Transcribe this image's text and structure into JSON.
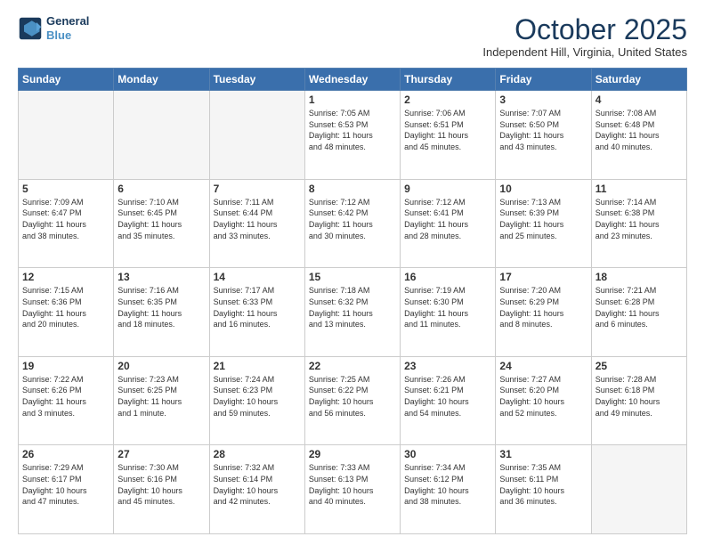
{
  "header": {
    "logo_line1": "General",
    "logo_line2": "Blue",
    "month": "October 2025",
    "location": "Independent Hill, Virginia, United States"
  },
  "weekdays": [
    "Sunday",
    "Monday",
    "Tuesday",
    "Wednesday",
    "Thursday",
    "Friday",
    "Saturday"
  ],
  "weeks": [
    [
      {
        "day": "",
        "info": ""
      },
      {
        "day": "",
        "info": ""
      },
      {
        "day": "",
        "info": ""
      },
      {
        "day": "1",
        "info": "Sunrise: 7:05 AM\nSunset: 6:53 PM\nDaylight: 11 hours\nand 48 minutes."
      },
      {
        "day": "2",
        "info": "Sunrise: 7:06 AM\nSunset: 6:51 PM\nDaylight: 11 hours\nand 45 minutes."
      },
      {
        "day": "3",
        "info": "Sunrise: 7:07 AM\nSunset: 6:50 PM\nDaylight: 11 hours\nand 43 minutes."
      },
      {
        "day": "4",
        "info": "Sunrise: 7:08 AM\nSunset: 6:48 PM\nDaylight: 11 hours\nand 40 minutes."
      }
    ],
    [
      {
        "day": "5",
        "info": "Sunrise: 7:09 AM\nSunset: 6:47 PM\nDaylight: 11 hours\nand 38 minutes."
      },
      {
        "day": "6",
        "info": "Sunrise: 7:10 AM\nSunset: 6:45 PM\nDaylight: 11 hours\nand 35 minutes."
      },
      {
        "day": "7",
        "info": "Sunrise: 7:11 AM\nSunset: 6:44 PM\nDaylight: 11 hours\nand 33 minutes."
      },
      {
        "day": "8",
        "info": "Sunrise: 7:12 AM\nSunset: 6:42 PM\nDaylight: 11 hours\nand 30 minutes."
      },
      {
        "day": "9",
        "info": "Sunrise: 7:12 AM\nSunset: 6:41 PM\nDaylight: 11 hours\nand 28 minutes."
      },
      {
        "day": "10",
        "info": "Sunrise: 7:13 AM\nSunset: 6:39 PM\nDaylight: 11 hours\nand 25 minutes."
      },
      {
        "day": "11",
        "info": "Sunrise: 7:14 AM\nSunset: 6:38 PM\nDaylight: 11 hours\nand 23 minutes."
      }
    ],
    [
      {
        "day": "12",
        "info": "Sunrise: 7:15 AM\nSunset: 6:36 PM\nDaylight: 11 hours\nand 20 minutes."
      },
      {
        "day": "13",
        "info": "Sunrise: 7:16 AM\nSunset: 6:35 PM\nDaylight: 11 hours\nand 18 minutes."
      },
      {
        "day": "14",
        "info": "Sunrise: 7:17 AM\nSunset: 6:33 PM\nDaylight: 11 hours\nand 16 minutes."
      },
      {
        "day": "15",
        "info": "Sunrise: 7:18 AM\nSunset: 6:32 PM\nDaylight: 11 hours\nand 13 minutes."
      },
      {
        "day": "16",
        "info": "Sunrise: 7:19 AM\nSunset: 6:30 PM\nDaylight: 11 hours\nand 11 minutes."
      },
      {
        "day": "17",
        "info": "Sunrise: 7:20 AM\nSunset: 6:29 PM\nDaylight: 11 hours\nand 8 minutes."
      },
      {
        "day": "18",
        "info": "Sunrise: 7:21 AM\nSunset: 6:28 PM\nDaylight: 11 hours\nand 6 minutes."
      }
    ],
    [
      {
        "day": "19",
        "info": "Sunrise: 7:22 AM\nSunset: 6:26 PM\nDaylight: 11 hours\nand 3 minutes."
      },
      {
        "day": "20",
        "info": "Sunrise: 7:23 AM\nSunset: 6:25 PM\nDaylight: 11 hours\nand 1 minute."
      },
      {
        "day": "21",
        "info": "Sunrise: 7:24 AM\nSunset: 6:23 PM\nDaylight: 10 hours\nand 59 minutes."
      },
      {
        "day": "22",
        "info": "Sunrise: 7:25 AM\nSunset: 6:22 PM\nDaylight: 10 hours\nand 56 minutes."
      },
      {
        "day": "23",
        "info": "Sunrise: 7:26 AM\nSunset: 6:21 PM\nDaylight: 10 hours\nand 54 minutes."
      },
      {
        "day": "24",
        "info": "Sunrise: 7:27 AM\nSunset: 6:20 PM\nDaylight: 10 hours\nand 52 minutes."
      },
      {
        "day": "25",
        "info": "Sunrise: 7:28 AM\nSunset: 6:18 PM\nDaylight: 10 hours\nand 49 minutes."
      }
    ],
    [
      {
        "day": "26",
        "info": "Sunrise: 7:29 AM\nSunset: 6:17 PM\nDaylight: 10 hours\nand 47 minutes."
      },
      {
        "day": "27",
        "info": "Sunrise: 7:30 AM\nSunset: 6:16 PM\nDaylight: 10 hours\nand 45 minutes."
      },
      {
        "day": "28",
        "info": "Sunrise: 7:32 AM\nSunset: 6:14 PM\nDaylight: 10 hours\nand 42 minutes."
      },
      {
        "day": "29",
        "info": "Sunrise: 7:33 AM\nSunset: 6:13 PM\nDaylight: 10 hours\nand 40 minutes."
      },
      {
        "day": "30",
        "info": "Sunrise: 7:34 AM\nSunset: 6:12 PM\nDaylight: 10 hours\nand 38 minutes."
      },
      {
        "day": "31",
        "info": "Sunrise: 7:35 AM\nSunset: 6:11 PM\nDaylight: 10 hours\nand 36 minutes."
      },
      {
        "day": "",
        "info": ""
      }
    ]
  ]
}
